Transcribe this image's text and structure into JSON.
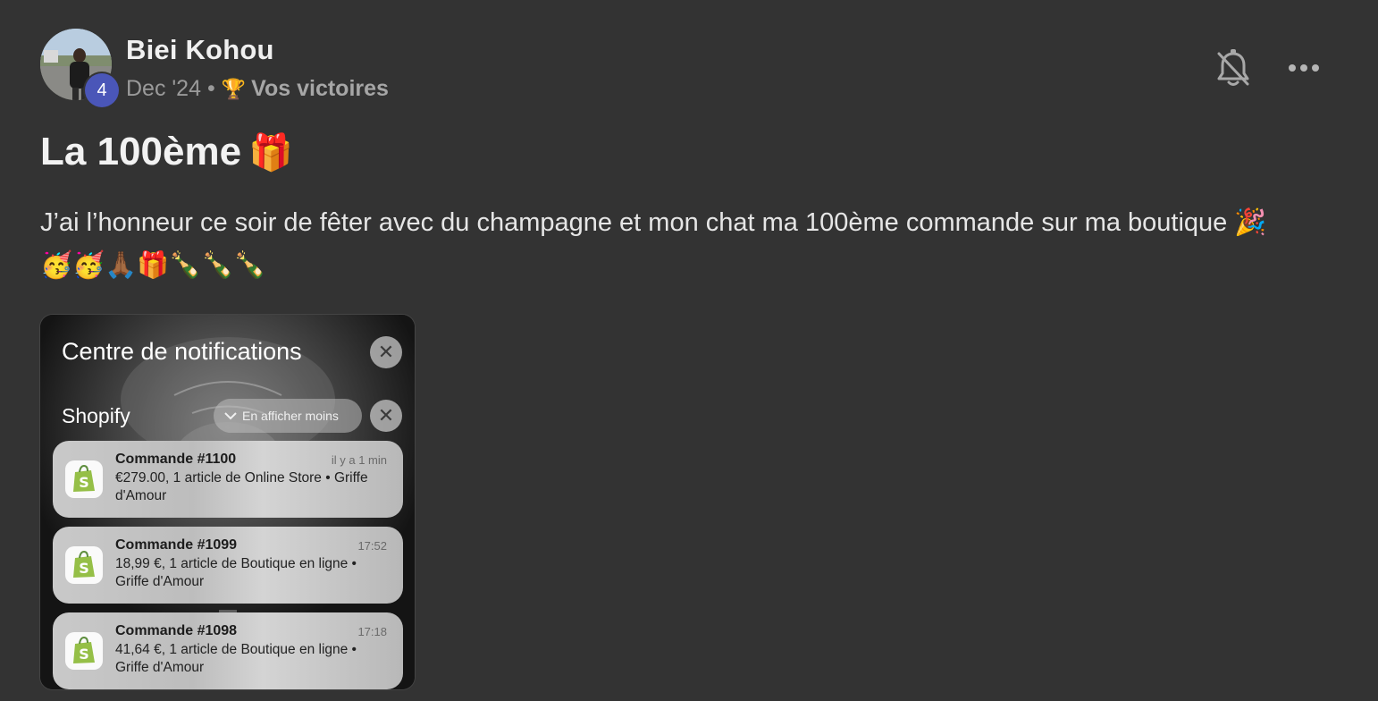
{
  "author": {
    "name": "Biei Kohou",
    "level": "4"
  },
  "meta": {
    "date": "Dec '24",
    "separator": "•",
    "space_icon": "🏆",
    "space_name": "Vos victoires"
  },
  "actions": {
    "bell_icon": "bell-off-icon",
    "more_icon": "more-horizontal-icon"
  },
  "post": {
    "title": "La 100ème",
    "title_emoji": "🎁",
    "text": "J’ai l’honneur ce soir de fêter avec du champagne et mon chat ma 100ème commande sur ma boutique 🎉🥳🥳🙏🏾🎁🍾🍾🍾"
  },
  "attachment": {
    "notification_center_title": "Centre de notifications",
    "close_glyph": "✕",
    "group_name": "Shopify",
    "show_less_label": "En afficher moins",
    "notifications": [
      {
        "title": "Commande #1100",
        "time": "il y a 1 min",
        "body": "€279.00, 1 article de Online Store • Griffe d'Amour"
      },
      {
        "title": "Commande #1099",
        "time": "17:52",
        "body": "18,99 €, 1 article de Boutique en ligne • Griffe d'Amour"
      },
      {
        "title": "Commande #1098",
        "time": "17:18",
        "body": "41,64 €, 1 article de Boutique en ligne • Griffe d'Amour"
      }
    ]
  },
  "colors": {
    "background": "#333333",
    "badge": "#4a56b8",
    "shopify_green": "#95bf47"
  }
}
